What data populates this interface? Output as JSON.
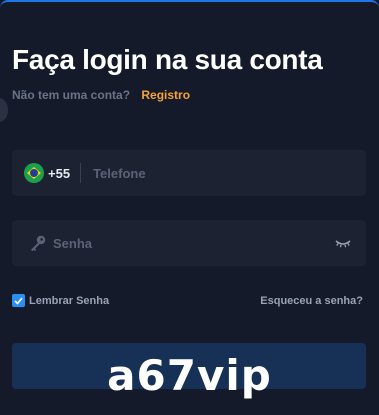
{
  "login": {
    "title": "Faça login na sua conta",
    "no_account_text": "Não tem uma conta?",
    "register_link": "Registro",
    "phone": {
      "flag_icon": "brazil-flag-icon",
      "dial_code": "+55",
      "placeholder": "Telefone"
    },
    "password": {
      "lock_icon": "key-icon",
      "placeholder": "Senha",
      "toggle_icon": "eye-closed-icon"
    },
    "remember_label": "Lembrar Senha",
    "remember_checked": true,
    "forgot_link": "Esqueceu a senha?"
  },
  "overlay": {
    "watermark_text": "a67vip"
  },
  "colors": {
    "background": "#141a2a",
    "field": "#1c2232",
    "accent_link": "#f2a33a",
    "checkbox": "#2b8ff0",
    "button": "#173056",
    "top_border": "#1d77e6"
  }
}
